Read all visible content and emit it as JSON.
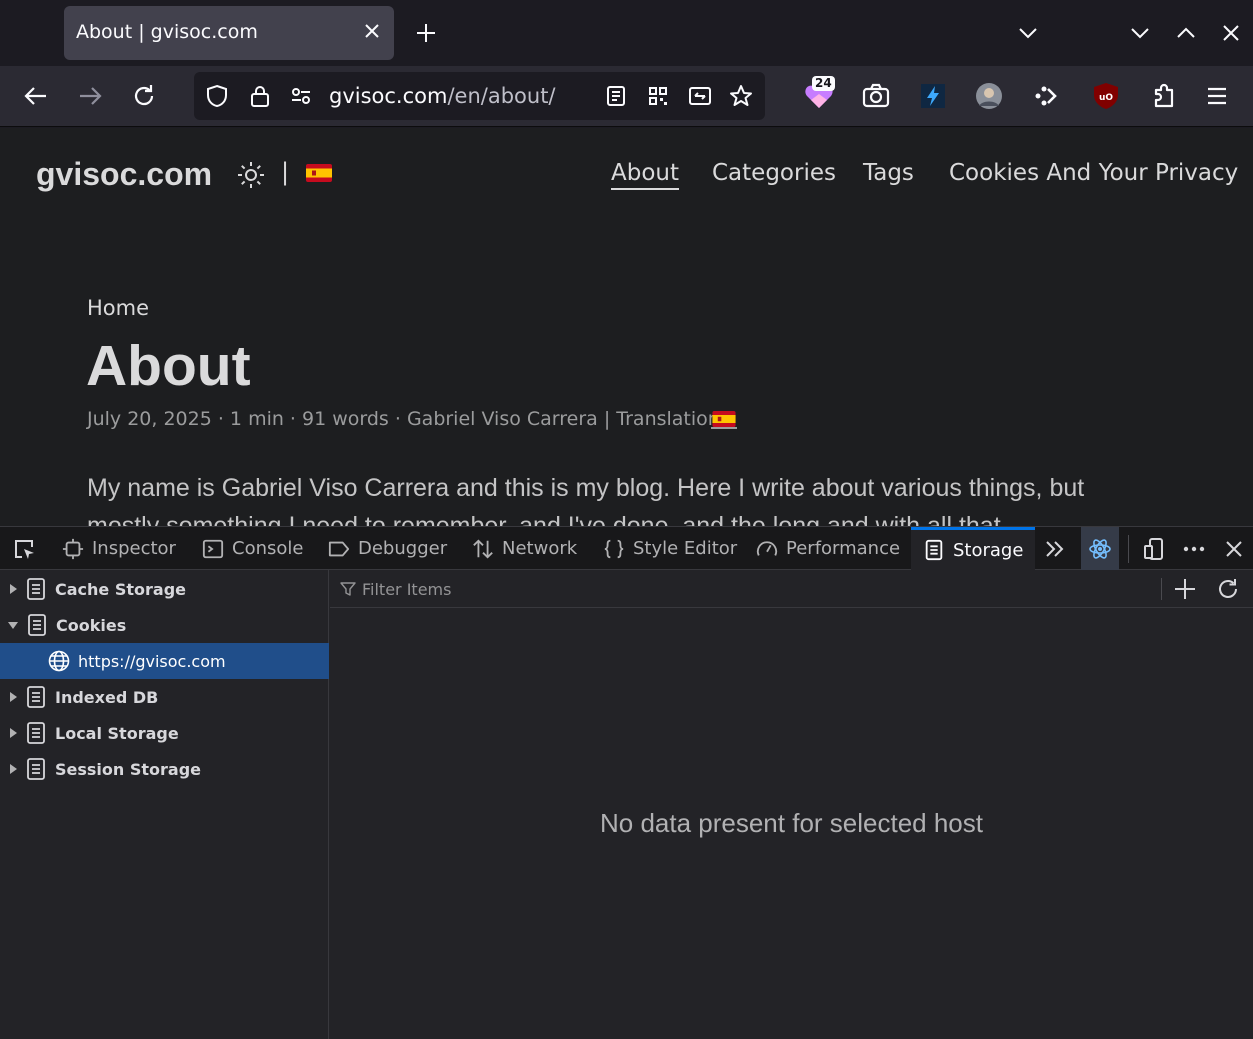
{
  "browser": {
    "tab_title": "About | gvisoc.com",
    "url_host": "gvisoc.com",
    "url_path": "/en/about/",
    "extension_badge": "24"
  },
  "site": {
    "logo": "gvisoc.com",
    "separator": "|",
    "menu": [
      "About",
      "Categories",
      "Tags",
      "Cookies And Your Privacy"
    ],
    "active_menu": "About"
  },
  "article": {
    "breadcrumb": "Home",
    "title": "About",
    "meta": "July 20, 2025 · 1 min · 91 words · Gabriel Viso Carrera | Translations:",
    "paragraph": "My name is Gabriel Viso Carrera and this is my blog. Here I write about various things, but",
    "paragraph_cut": "mostly something I need to remember, and I've done, and the long and with all that"
  },
  "devtools": {
    "tabs": [
      "Inspector",
      "Console",
      "Debugger",
      "Network",
      "Style Editor",
      "Performance",
      "Storage"
    ],
    "selected_tab": "Storage",
    "tree": [
      {
        "label": "Cache Storage",
        "expanded": false
      },
      {
        "label": "Cookies",
        "expanded": true
      },
      {
        "label": "https://gvisoc.com",
        "selected": true
      },
      {
        "label": "Indexed DB",
        "expanded": false
      },
      {
        "label": "Local Storage",
        "expanded": false
      },
      {
        "label": "Session Storage",
        "expanded": false
      }
    ],
    "filter_placeholder": "Filter Items",
    "empty_message": "No data present for selected host"
  },
  "colors": {
    "accent": "#0074e8",
    "selection": "#204e8a",
    "flag_red": "#c60b1e",
    "flag_yellow": "#ffc400"
  }
}
